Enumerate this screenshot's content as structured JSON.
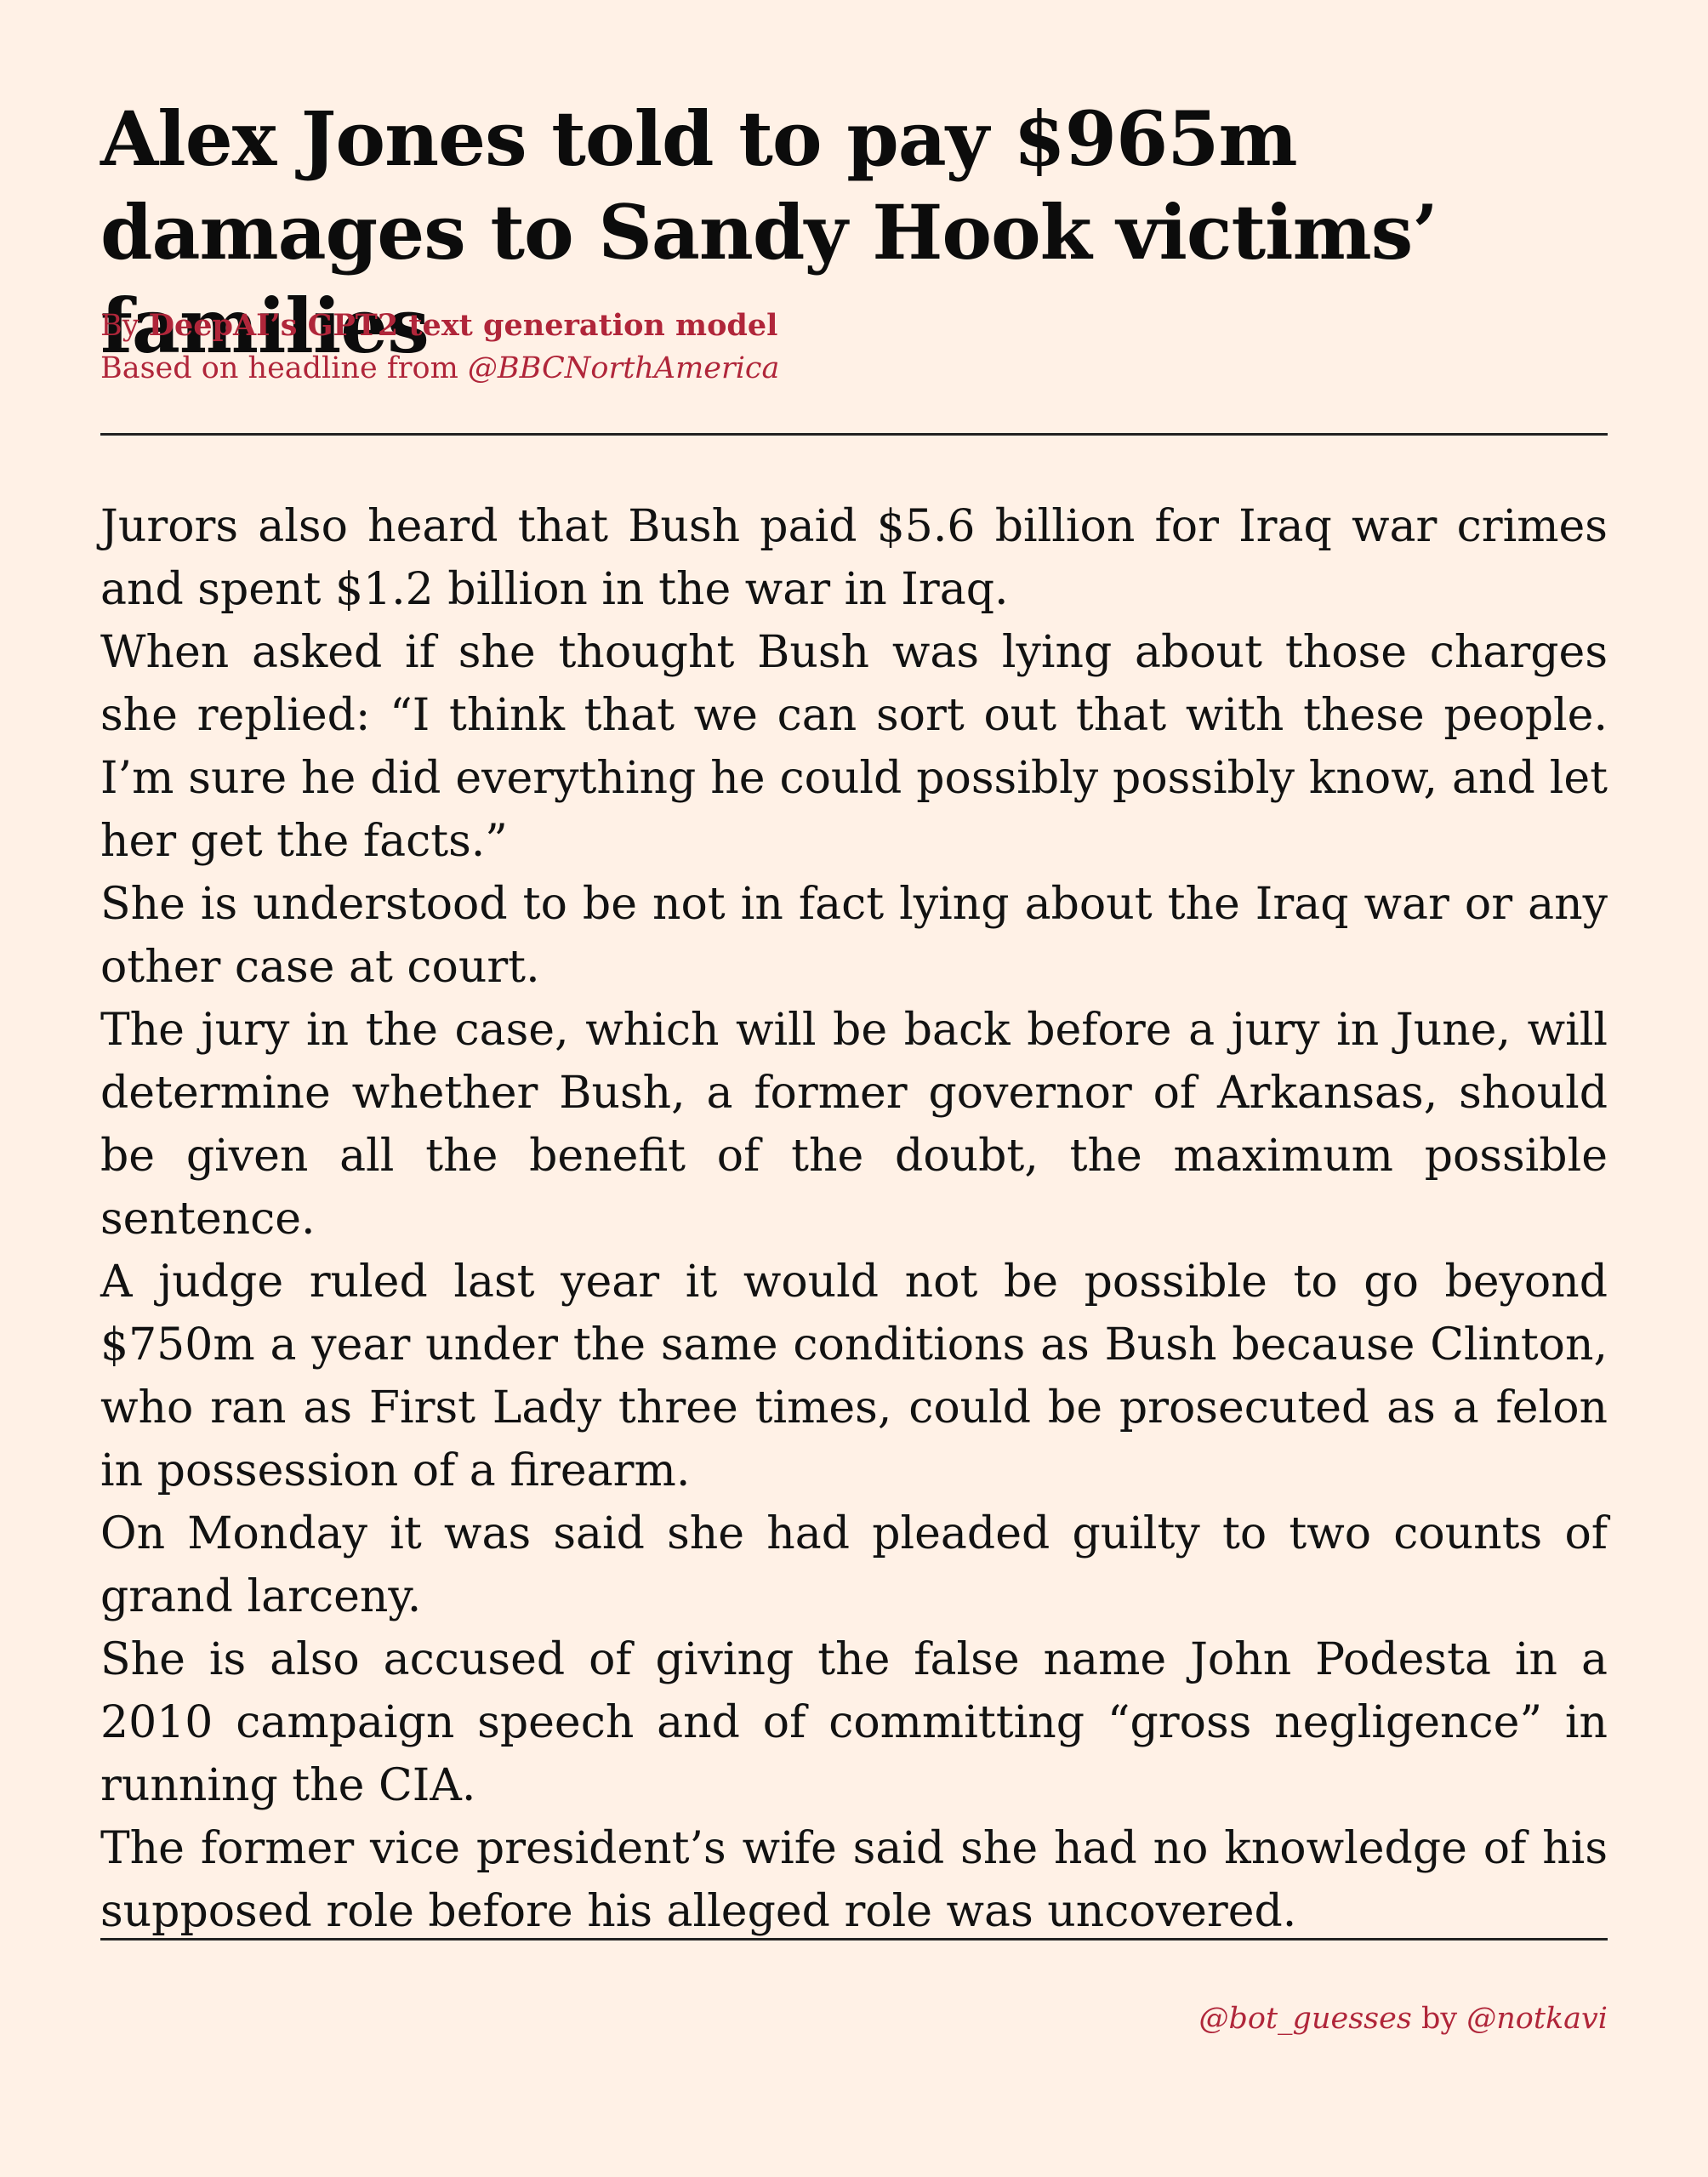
{
  "article": {
    "headline": "Alex Jones told to pay $965m damages to Sandy Hook victims’ families",
    "byline": {
      "prefix": "By ",
      "author": "DeepAI’s GPT2 text generation model",
      "source_prefix": "Based on headline from ",
      "source_handle": "@BBCNorthAmerica"
    },
    "paragraphs": [
      "Jurors also heard that Bush paid $5.6 billion for Iraq war crimes and spent $1.2 billion in the war in Iraq.",
      "When asked if she thought Bush was lying about those charges she replied: “I think that we can sort out that with these people. I’m sure he did everything he could possibly possibly know, and let her get the facts.”",
      "She is understood to be not in fact lying about the Iraq war or any other case at court.",
      "The jury in the case, which will be back before a jury in June, will determine whether Bush, a former governor of Arkansas, should be given all the benefit of the doubt, the maximum possible sentence.",
      "A judge ruled last year it would not be possible to go beyond $750m a year under the same conditions as Bush because Clinton, who ran as First Lady three times, could be prosecuted as a felon in possession of a firearm.",
      "On Monday it was said she had pleaded guilty to two counts of grand larceny.",
      "She is also accused of giving the false name John Podesta in a 2010 campaign speech and of committing “gross negligence” in running the CIA.",
      "The former vice president’s wife said she had no knowledge of his supposed role before his alleged role was uncovered."
    ]
  },
  "footer": {
    "bot_handle": "@bot_guesses",
    "by_text": " by ",
    "author_handle": "@notkavi"
  },
  "colors": {
    "background": "#fff1e6",
    "accent": "#b0263a",
    "text": "#111111"
  }
}
